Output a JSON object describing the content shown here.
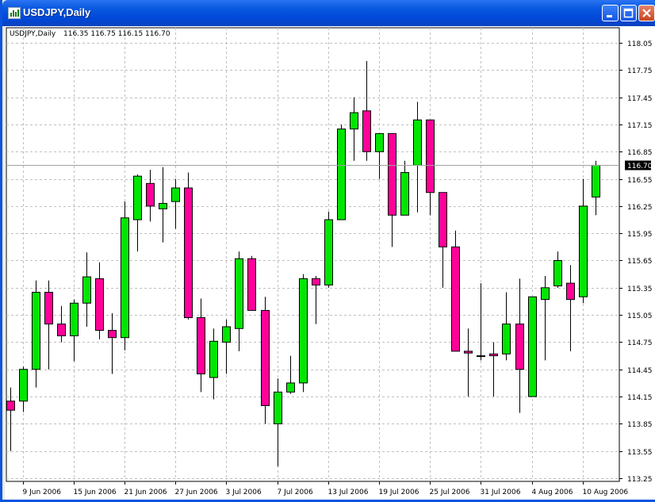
{
  "window": {
    "title": "USDJPY,Daily"
  },
  "chart_data": {
    "type": "candlestick",
    "info": {
      "symbol": "USDJPY,Daily",
      "ohlc": "116.35 116.75 116.15 116.70"
    },
    "last_price_label": "116.70",
    "ylim": [
      113.1,
      118.3
    ],
    "y_ticks": [
      "118.05",
      "117.75",
      "117.45",
      "117.15",
      "116.85",
      "116.55",
      "116.25",
      "115.95",
      "115.65",
      "115.35",
      "115.05",
      "114.75",
      "114.45",
      "114.15",
      "113.85",
      "113.55",
      "113.25"
    ],
    "x_ticks": [
      "9 Jun 2006",
      "15 Jun 2006",
      "21 Jun 2006",
      "27 Jun 2006",
      "3 Jul 2006",
      "7 Jul 2006",
      "13 Jul 2006",
      "19 Jul 2006",
      "25 Jul 2006",
      "31 Jul 2006",
      "4 Aug 2006",
      "10 Aug 2006"
    ],
    "grid": true,
    "colors": {
      "bull": "#00E600",
      "bear": "#FF0099",
      "grid": "#C0C0C0",
      "wick": "#000000"
    },
    "candles": [
      {
        "o": 114.1,
        "h": 114.25,
        "l": 113.55,
        "c": 114.0
      },
      {
        "o": 114.1,
        "h": 114.48,
        "l": 113.98,
        "c": 114.45
      },
      {
        "o": 114.45,
        "h": 115.43,
        "l": 114.25,
        "c": 115.3
      },
      {
        "o": 115.3,
        "h": 115.43,
        "l": 114.45,
        "c": 114.95
      },
      {
        "o": 114.95,
        "h": 115.15,
        "l": 114.75,
        "c": 114.82
      },
      {
        "o": 114.82,
        "h": 115.22,
        "l": 114.54,
        "c": 115.18
      },
      {
        "o": 115.18,
        "h": 115.74,
        "l": 114.92,
        "c": 115.47
      },
      {
        "o": 115.45,
        "h": 115.63,
        "l": 114.78,
        "c": 114.88
      },
      {
        "o": 114.88,
        "h": 115.07,
        "l": 114.4,
        "c": 114.8
      },
      {
        "o": 114.8,
        "h": 116.3,
        "l": 114.66,
        "c": 116.12
      },
      {
        "o": 116.1,
        "h": 116.6,
        "l": 115.75,
        "c": 116.58
      },
      {
        "o": 116.5,
        "h": 116.65,
        "l": 116.08,
        "c": 116.25
      },
      {
        "o": 116.22,
        "h": 116.68,
        "l": 115.85,
        "c": 116.28
      },
      {
        "o": 116.3,
        "h": 116.55,
        "l": 116.0,
        "c": 116.45
      },
      {
        "o": 116.45,
        "h": 116.62,
        "l": 115.0,
        "c": 115.02
      },
      {
        "o": 115.02,
        "h": 115.23,
        "l": 114.2,
        "c": 114.4
      },
      {
        "o": 114.36,
        "h": 114.9,
        "l": 114.12,
        "c": 114.76
      },
      {
        "o": 114.75,
        "h": 115.0,
        "l": 114.4,
        "c": 114.92
      },
      {
        "o": 114.9,
        "h": 115.75,
        "l": 114.65,
        "c": 115.67
      },
      {
        "o": 115.67,
        "h": 115.7,
        "l": 115.15,
        "c": 115.1
      },
      {
        "o": 115.1,
        "h": 115.25,
        "l": 113.85,
        "c": 114.05
      },
      {
        "o": 113.85,
        "h": 114.35,
        "l": 113.38,
        "c": 114.2
      },
      {
        "o": 114.2,
        "h": 114.6,
        "l": 114.18,
        "c": 114.3
      },
      {
        "o": 114.3,
        "h": 115.5,
        "l": 114.2,
        "c": 115.45
      },
      {
        "o": 115.45,
        "h": 115.48,
        "l": 114.95,
        "c": 115.38
      },
      {
        "o": 115.38,
        "h": 116.19,
        "l": 115.35,
        "c": 116.1
      },
      {
        "o": 116.1,
        "h": 117.15,
        "l": 116.1,
        "c": 117.1
      },
      {
        "o": 117.1,
        "h": 117.45,
        "l": 116.75,
        "c": 117.28
      },
      {
        "o": 117.3,
        "h": 117.85,
        "l": 116.75,
        "c": 116.85
      },
      {
        "o": 116.85,
        "h": 117.05,
        "l": 116.55,
        "c": 117.05
      },
      {
        "o": 117.05,
        "h": 117.05,
        "l": 115.8,
        "c": 116.15
      },
      {
        "o": 116.15,
        "h": 116.75,
        "l": 116.15,
        "c": 116.62
      },
      {
        "o": 116.7,
        "h": 117.4,
        "l": 116.18,
        "c": 117.2
      },
      {
        "o": 117.2,
        "h": 117.2,
        "l": 116.15,
        "c": 116.4
      },
      {
        "o": 116.4,
        "h": 116.4,
        "l": 115.35,
        "c": 115.8
      },
      {
        "o": 115.8,
        "h": 115.98,
        "l": 114.85,
        "c": 114.65
      },
      {
        "o": 114.65,
        "h": 114.9,
        "l": 114.15,
        "c": 114.63
      },
      {
        "o": 114.6,
        "h": 115.4,
        "l": 114.55,
        "c": 114.6
      },
      {
        "o": 114.62,
        "h": 114.75,
        "l": 114.15,
        "c": 114.6
      },
      {
        "o": 114.62,
        "h": 115.3,
        "l": 114.55,
        "c": 114.95
      },
      {
        "o": 114.95,
        "h": 115.45,
        "l": 113.97,
        "c": 114.45
      },
      {
        "o": 114.15,
        "h": 115.25,
        "l": 114.15,
        "c": 115.25
      },
      {
        "o": 115.22,
        "h": 115.48,
        "l": 114.55,
        "c": 115.35
      },
      {
        "o": 115.37,
        "h": 115.75,
        "l": 115.35,
        "c": 115.65
      },
      {
        "o": 115.4,
        "h": 115.6,
        "l": 114.65,
        "c": 115.22
      },
      {
        "o": 115.25,
        "h": 116.55,
        "l": 115.18,
        "c": 116.25
      },
      {
        "o": 116.35,
        "h": 116.75,
        "l": 116.15,
        "c": 116.7
      }
    ]
  }
}
